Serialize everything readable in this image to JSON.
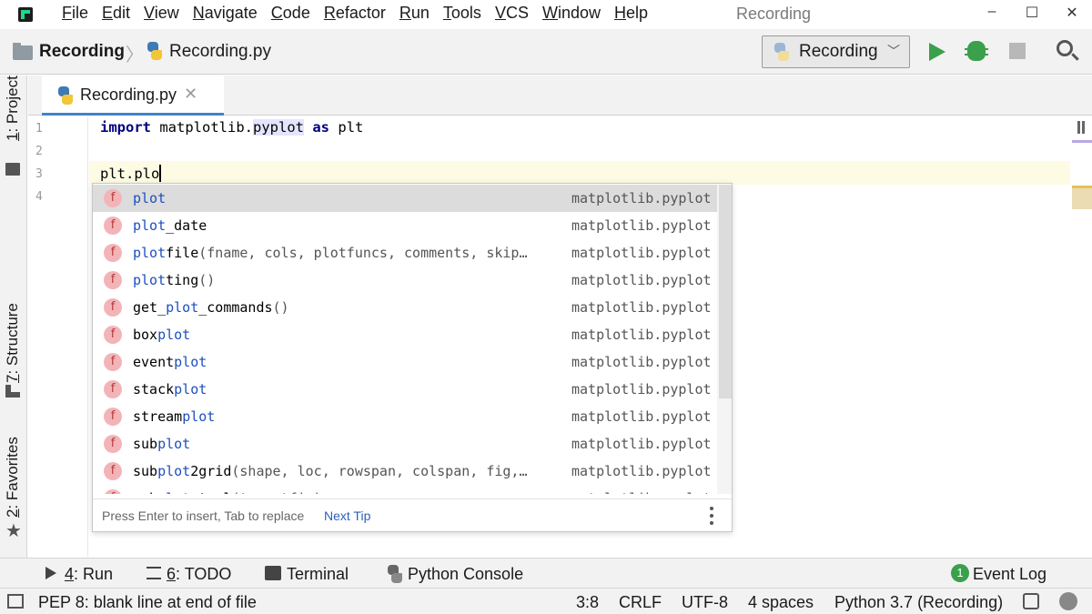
{
  "window": {
    "title": "Recording",
    "menu": [
      {
        "mn": "F",
        "rest": "ile"
      },
      {
        "mn": "E",
        "rest": "dit"
      },
      {
        "mn": "V",
        "rest": "iew"
      },
      {
        "mn": "N",
        "rest": "avigate"
      },
      {
        "mn": "C",
        "rest": "ode"
      },
      {
        "mn": "R",
        "rest": "efactor"
      },
      {
        "mn": "R",
        "rest": "un"
      },
      {
        "mn": "T",
        "rest": "ools"
      },
      {
        "mn": "V",
        "rest": "CS"
      },
      {
        "mn": "W",
        "rest": "indow"
      },
      {
        "mn": "H",
        "rest": "elp"
      }
    ],
    "controls": {
      "minimize": "–",
      "maximize": "☐",
      "close": "✕"
    }
  },
  "navbar": {
    "project": "Recording",
    "file": "Recording.py",
    "run_config": "Recording"
  },
  "tool_strip": {
    "project": {
      "mn": "1",
      "rest": ": Project"
    },
    "structure": {
      "mn": "7",
      "rest": ": Structure"
    },
    "favorites": {
      "mn": "2",
      "rest": ": Favorites"
    }
  },
  "editor": {
    "tab_label": "Recording.py",
    "line_numbers": [
      "1",
      "2",
      "3",
      "4"
    ],
    "line1": {
      "kw_import": "import",
      "mod": "matplotlib.",
      "sub": "pyplot",
      "kw_as": "as",
      "alias": "plt"
    },
    "line3": "plt.plo"
  },
  "completion": {
    "items": [
      {
        "match": "plot",
        "before": "",
        "after": "",
        "sig": "",
        "module": "matplotlib.pyplot",
        "selected": true
      },
      {
        "match": "plot",
        "before": "",
        "after": "_date",
        "sig": "",
        "module": "matplotlib.pyplot"
      },
      {
        "match": "plot",
        "before": "",
        "after": "file",
        "sig": "(fname, cols, plotfuncs, comments, skip…",
        "module": "matplotlib.pyplot"
      },
      {
        "match": "plot",
        "before": "",
        "after": "ting",
        "sig": "()",
        "module": "matplotlib.pyplot"
      },
      {
        "match": "plot",
        "before": "get_",
        "after": "_commands",
        "sig": "()",
        "module": "matplotlib.pyplot"
      },
      {
        "match": "plot",
        "before": "box",
        "after": "",
        "sig": "",
        "module": "matplotlib.pyplot"
      },
      {
        "match": "plot",
        "before": "event",
        "after": "",
        "sig": "",
        "module": "matplotlib.pyplot"
      },
      {
        "match": "plot",
        "before": "stack",
        "after": "",
        "sig": "",
        "module": "matplotlib.pyplot"
      },
      {
        "match": "plot",
        "before": "stream",
        "after": "",
        "sig": "",
        "module": "matplotlib.pyplot"
      },
      {
        "match": "plot",
        "before": "sub",
        "after": "",
        "sig": "",
        "module": "matplotlib.pyplot"
      },
      {
        "match": "plot",
        "before": "sub",
        "after": "2grid",
        "sig": "(shape, loc, rowspan, colspan, fig,…",
        "module": "matplotlib.pyplot"
      },
      {
        "match": "plot",
        "before": "sub",
        "after": "_tool",
        "sig": "(targetfig)",
        "module": "matplotlib.pyplot"
      }
    ],
    "footer_hint": "Press Enter to insert, Tab to replace",
    "footer_link": "Next Tip",
    "icon_letter": "f"
  },
  "bottom_tools": {
    "run": {
      "mn": "4",
      "rest": ": Run"
    },
    "todo": {
      "mn": "6",
      "rest": ": TODO"
    },
    "terminal": "Terminal",
    "python_console": "Python Console",
    "event_log": "Event Log",
    "event_count": "1"
  },
  "status_bar": {
    "message": "PEP 8: blank line at end of file",
    "position": "3:8",
    "line_sep": "CRLF",
    "encoding": "UTF-8",
    "indent": "4 spaces",
    "interpreter": "Python 3.7 (Recording)"
  },
  "colors": {
    "accent_blue": "#4083c9",
    "run_green": "#3aa04b",
    "func_icon": "#f3b4b8",
    "match_blue": "#1d4fbf"
  }
}
